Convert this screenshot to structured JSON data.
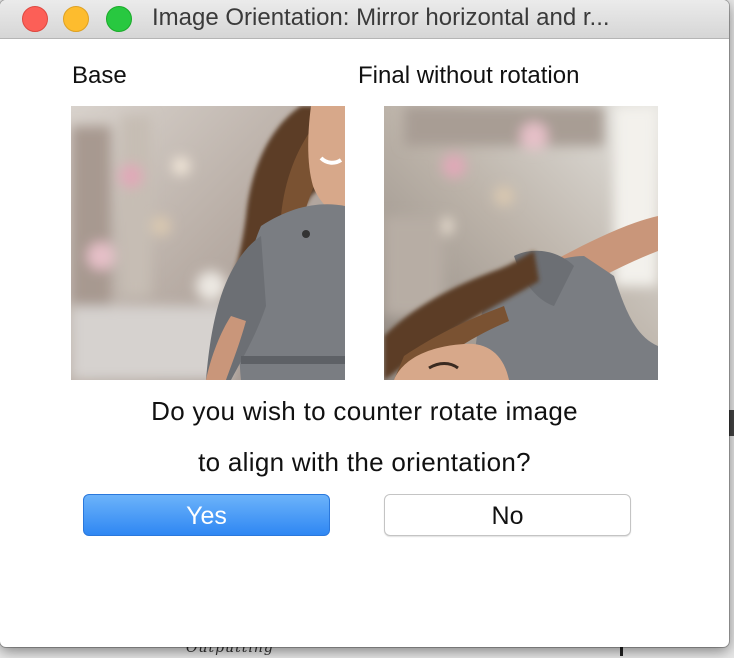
{
  "window": {
    "title": "Image Orientation: Mirror horizontal and r..."
  },
  "labels": {
    "base": "Base",
    "final": "Final without rotation"
  },
  "question": {
    "line1": "Do you wish to counter rotate image",
    "line2": "to align with the orientation?"
  },
  "buttons": {
    "yes": "Yes",
    "no": "No"
  },
  "background": {
    "peek_text": "Outputting"
  },
  "colors": {
    "primary_button": "#2f87f3",
    "close": "#fc5f57",
    "minimize": "#fdbc2e",
    "maximize": "#28c840"
  }
}
